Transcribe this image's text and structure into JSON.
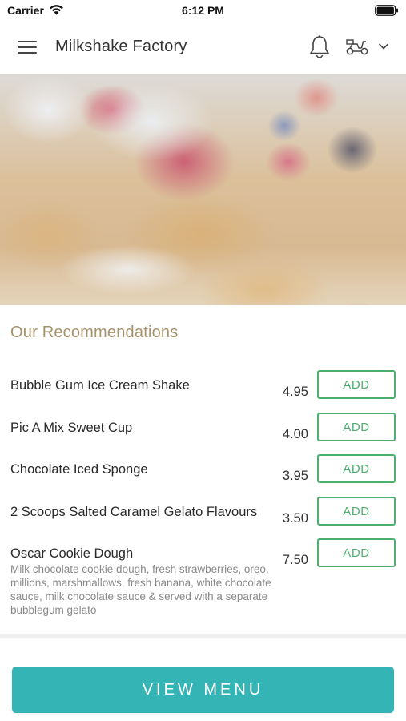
{
  "status_bar": {
    "carrier": "Carrier",
    "time": "6:12 PM",
    "icons": [
      "wifi-icon",
      "battery-icon"
    ]
  },
  "header": {
    "title": "Milkshake Factory",
    "icons": [
      "menu-icon",
      "bell-icon",
      "scooter-icon",
      "chevron-down-icon"
    ]
  },
  "hero": {
    "image": "waffles with cream, berry compote, strawberries, raspberries and blackberries"
  },
  "recommendations": {
    "title": "Our Recommendations",
    "add_label": "ADD",
    "items": [
      {
        "name": "Bubble Gum Ice Cream Shake",
        "price": "4.95",
        "description": ""
      },
      {
        "name": "Pic A Mix Sweet Cup",
        "price": "4.00",
        "description": ""
      },
      {
        "name": "Chocolate Iced Sponge",
        "price": "3.95",
        "description": ""
      },
      {
        "name": "2 Scoops Salted Caramel Gelato Flavours",
        "price": "3.50",
        "description": ""
      },
      {
        "name": "Oscar Cookie Dough",
        "price": "7.50",
        "description": "Milk chocolate cookie dough, fresh strawberries, oreo, millions, marshmallows, fresh banana, white chocolate sauce, milk chocolate sauce & served with a separate bubblegum gelato"
      }
    ]
  },
  "footer": {
    "view_menu_label": "VIEW MENU"
  },
  "colors": {
    "accent_teal": "#35b4b6",
    "add_green": "#4caf6e",
    "section_title_gold": "#a6926a"
  }
}
